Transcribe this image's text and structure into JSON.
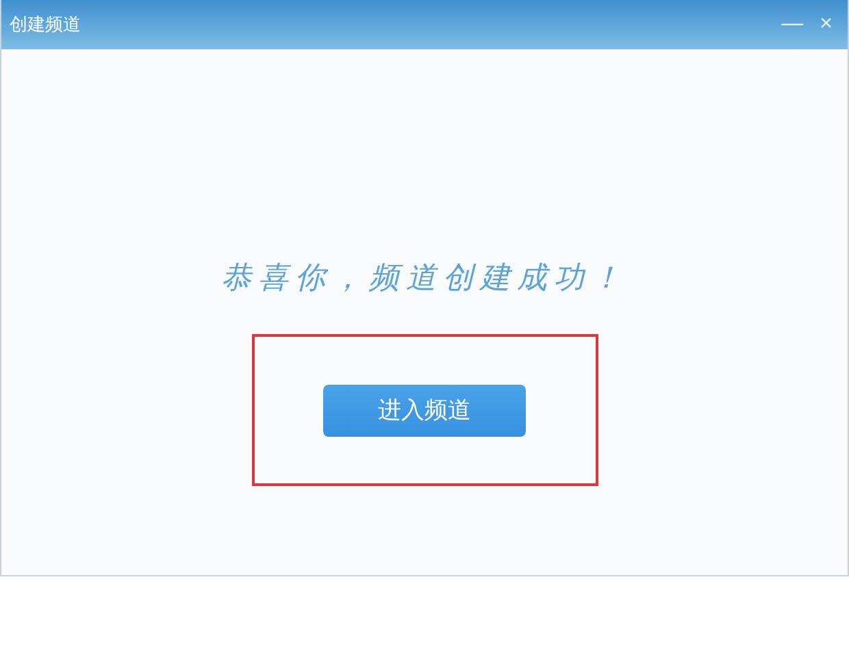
{
  "window": {
    "title": "创建频道",
    "controls": [
      "—",
      "×"
    ]
  },
  "message": "恭喜你，频道创建成功！",
  "highlight": {
    "shown": true
  },
  "buttons": [
    "进入频道"
  ]
}
